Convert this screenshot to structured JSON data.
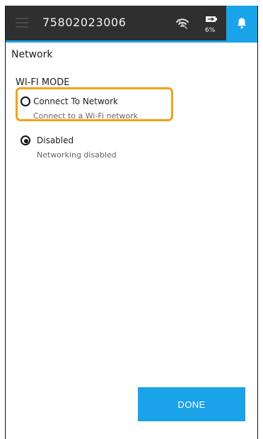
{
  "status_bar": {
    "device_id": "75802023006",
    "battery_percent": "6%",
    "wifi_icon": "wifi-disconnected-icon",
    "battery_icon": "battery-charging-icon",
    "notification_icon": "bell-icon"
  },
  "page": {
    "title": "Network",
    "section_title": "WI-FI MODE"
  },
  "options": [
    {
      "label": "Connect To Network",
      "description": "Connect to a Wi-Fi network",
      "selected": false
    },
    {
      "label": "Disabled",
      "description": "Networking disabled",
      "selected": true
    }
  ],
  "actions": {
    "done_label": "DONE"
  },
  "colors": {
    "top_bar": "#2f2f2f",
    "accent": "#1aa3e8",
    "highlight": "#f2a11a",
    "background": "#ffffff"
  }
}
